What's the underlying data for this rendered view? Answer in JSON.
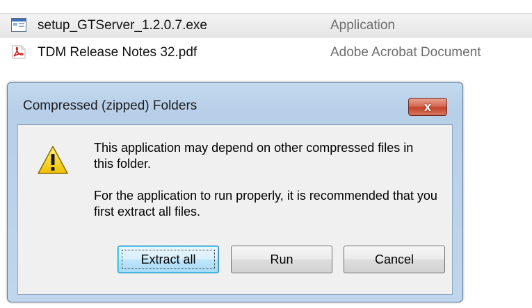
{
  "files": [
    {
      "name": "setup_GTServer_1.2.0.7.exe",
      "type": "Application",
      "icon": "exe-file-icon",
      "selected": true
    },
    {
      "name": "TDM Release Notes 32.pdf",
      "type": "Adobe Acrobat Document",
      "icon": "pdf-file-icon",
      "selected": false
    }
  ],
  "dialog": {
    "title": "Compressed (zipped) Folders",
    "close_glyph": "x",
    "icon": "warning-icon",
    "message_line1": "This application may depend on other compressed files in this folder.",
    "message_line2": "For the application to run properly, it is recommended that you first extract all files.",
    "buttons": {
      "extract_all": "Extract all",
      "run": "Run",
      "cancel": "Cancel"
    }
  },
  "colors": {
    "dialog_frame": "#b7cfe8",
    "close_button": "#c2432a",
    "default_button": "#3c7fb1",
    "warning": "#f5d01c"
  }
}
